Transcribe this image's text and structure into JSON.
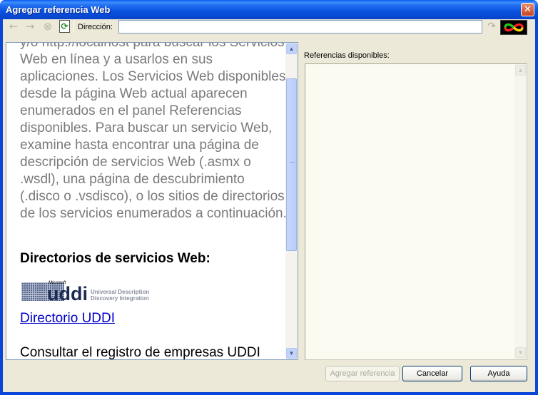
{
  "window": {
    "title": "Agregar referencia Web",
    "close_glyph": "✕"
  },
  "toolbar": {
    "back_icon": "←",
    "forward_icon": "→",
    "stop_icon": "⊗",
    "refresh_icon": "⟳",
    "address_label": "Dirección:",
    "address_value": "",
    "go_icon": "↷"
  },
  "browser": {
    "intro_text": "y/o http://localhost para buscar los Servicios Web en línea y a usarlos en sus aplicaciones. Los Servicios Web disponibles desde la página Web actual aparecen enumerados en el panel Referencias disponibles. Para buscar un servicio Web, examine hasta encontrar una página de descripción de servicios Web (.asmx o .wsdl), una página de descubrimiento (.disco o .vsdisco), o los sitios de directorios de los servicios enumerados a continuación.",
    "directories_heading": "Directorios de servicios Web:",
    "uddi_logo": {
      "brand": "Microsoft",
      "word": "uddi",
      "tagline_1": "Universal Description",
      "tagline_2": "Discovery Integration"
    },
    "uddi_link": "Directorio UDDI",
    "consult_text": "Consultar el registro de empresas UDDI"
  },
  "references": {
    "label": "Referencias disponibles:",
    "items": []
  },
  "buttons": {
    "add_reference": "Agregar referencia",
    "cancel": "Cancelar",
    "help": "Ayuda"
  },
  "colors": {
    "titlebar": "#0851dd",
    "dialog_bg": "#ece9d8",
    "link": "#0000cc"
  }
}
